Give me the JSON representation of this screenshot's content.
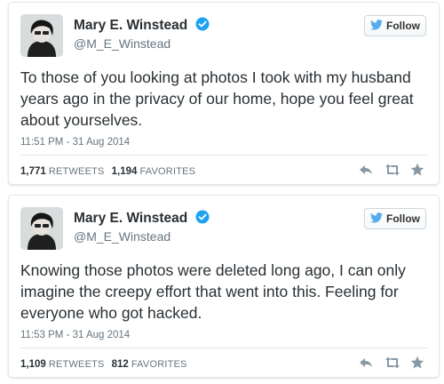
{
  "tweets": [
    {
      "name": "Mary E. Winstead",
      "handle": "@M_E_Winstead",
      "follow_label": "Follow",
      "text": "To those of you looking at photos I took with my husband years ago in the privacy of our home, hope you feel great about yourselves.",
      "timestamp": "11:51 PM - 31 Aug 2014",
      "retweets_count": "1,771",
      "retweets_label": "RETWEETS",
      "favorites_count": "1,194",
      "favorites_label": "FAVORITES"
    },
    {
      "name": "Mary E. Winstead",
      "handle": "@M_E_Winstead",
      "follow_label": "Follow",
      "text": "Knowing those photos were deleted long ago, I can only imagine the creepy effort that went into this. Feeling for everyone who got hacked.",
      "timestamp": "11:53 PM - 31 Aug 2014",
      "retweets_count": "1,109",
      "retweets_label": "RETWEETS",
      "favorites_count": "812",
      "favorites_label": "FAVORITES"
    }
  ],
  "colors": {
    "verified": "#1da1f2",
    "twitter_bird": "#55acee",
    "action_icon": "#8899a6",
    "muted_text": "#66757f"
  },
  "icons": [
    "verified-badge-icon",
    "twitter-bird-icon",
    "reply-icon",
    "retweet-icon",
    "favorite-star-icon"
  ]
}
